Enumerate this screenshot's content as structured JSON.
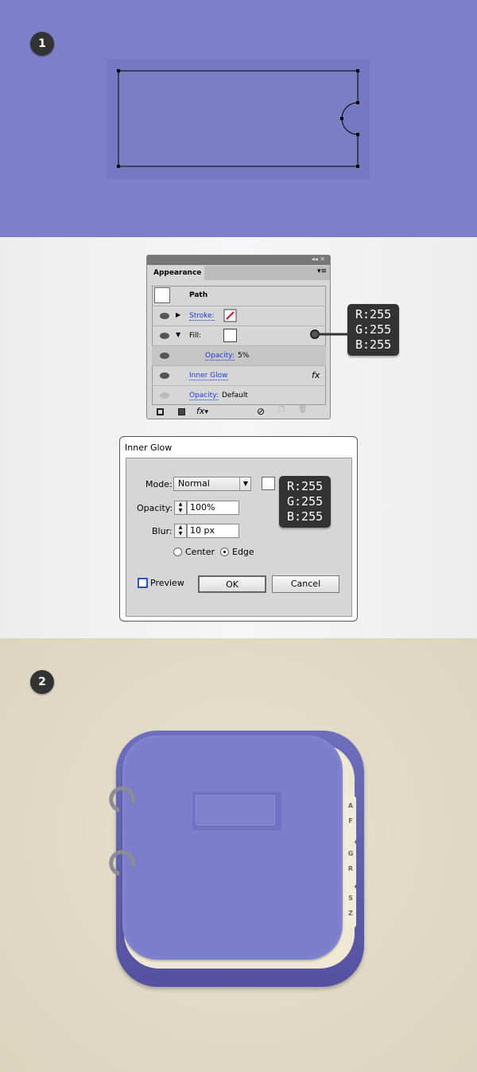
{
  "steps": {
    "one": "1",
    "two": "2"
  },
  "appearance": {
    "tab": "Appearance",
    "path": "Path",
    "stroke": "Stroke:",
    "fill": "Fill:",
    "fill_opacity_label": "Opacity:",
    "fill_opacity_value": "5%",
    "inner_glow": "Inner Glow",
    "fx": "fx",
    "opacity_label": "Opacity:",
    "opacity_value": "Default"
  },
  "fill_color": {
    "r": "R:255",
    "g": "G:255",
    "b": "B:255"
  },
  "inner_glow": {
    "title": "Inner Glow",
    "mode_label": "Mode:",
    "mode_value": "Normal",
    "opacity_label": "Opacity:",
    "opacity_value": "100%",
    "blur_label": "Blur:",
    "blur_value": "10 px",
    "center": "Center",
    "edge": "Edge",
    "preview": "Preview",
    "ok": "OK",
    "cancel": "Cancel",
    "color": {
      "r": "R:255",
      "g": "G:255",
      "b": "B:255"
    }
  },
  "icon_tabs": [
    "A",
    "F",
    "G",
    "R",
    "S",
    "Z"
  ],
  "colors": {
    "purple": "#7c80c9",
    "beige": "#ddd5c0",
    "panel": "#d6d6d6"
  }
}
